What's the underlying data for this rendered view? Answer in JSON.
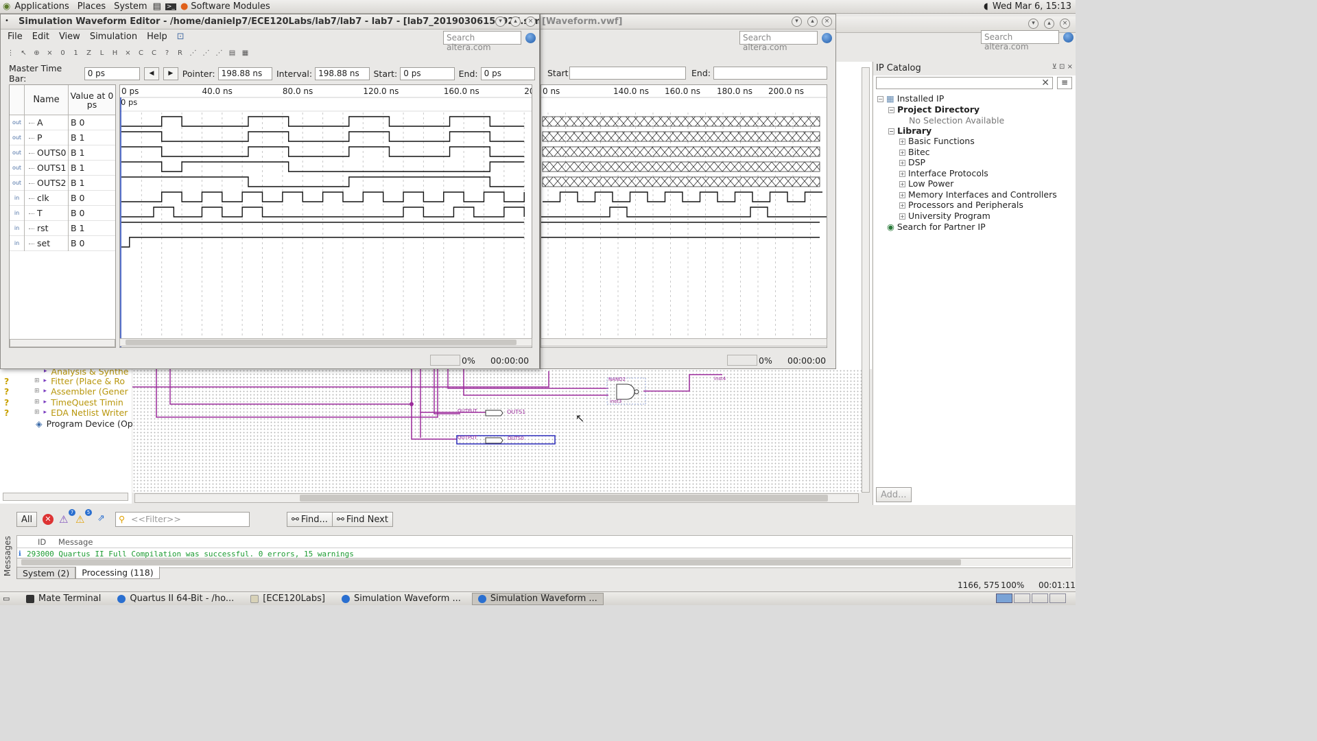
{
  "top_panel": {
    "menus": [
      "Applications",
      "Places",
      "System"
    ],
    "software_modules": "Software Modules",
    "clock": "Wed Mar  6, 15:13"
  },
  "waveform_editor": {
    "title": "Simulation Waveform Editor - /home/danielp7/ECE120Labs/lab7/lab7 - lab7 - [lab7_20190306150927.sim...",
    "search_placeholder": "Search altera.com",
    "menu": [
      "File",
      "Edit",
      "View",
      "Simulation",
      "Help"
    ],
    "master_time_bar_label": "Master Time Bar:",
    "master_time_bar_value": "0 ps",
    "pointer_label": "Pointer:",
    "pointer_value": "198.88 ns",
    "interval_label": "Interval:",
    "interval_value": "198.88 ns",
    "start_label": "Start:",
    "start_value": "0 ps",
    "end_label": "End:",
    "end_value": "0 ps",
    "col_name": "Name",
    "col_value": "Value at 0 ps",
    "time_ticks": [
      "0 ps",
      "40.0 ns",
      "80.0 ns",
      "120.0 ns",
      "160.0 ns",
      "200.0 ns"
    ],
    "cursor_label": "0 ps",
    "signals": [
      {
        "io": "out",
        "name": "A",
        "value": "B 0"
      },
      {
        "io": "out",
        "name": "P",
        "value": "B 1"
      },
      {
        "io": "out",
        "name": "OUTS0",
        "value": "B 1"
      },
      {
        "io": "out",
        "name": "OUTS1",
        "value": "B 1"
      },
      {
        "io": "out",
        "name": "OUTS2",
        "value": "B 1"
      },
      {
        "io": "in",
        "name": "clk",
        "value": "B 0"
      },
      {
        "io": "in",
        "name": "T",
        "value": "B 0"
      },
      {
        "io": "in",
        "name": "rst",
        "value": "B 1"
      },
      {
        "io": "in",
        "name": "set",
        "value": "B 0"
      }
    ],
    "progress": "0%",
    "elapsed": "00:00:00"
  },
  "waveform_editor_2": {
    "title_fragment": "[Waveform.vwf]",
    "search_placeholder": "Search altera.com",
    "start_label": "Start:",
    "end_label": "End:",
    "time_ticks": [
      "0 ns",
      "140.0 ns",
      "160.0 ns",
      "180.0 ns",
      "200.0 ns"
    ],
    "progress": "0%",
    "elapsed": "00:00:00"
  },
  "quartus": {
    "search_placeholder": "Search altera.com"
  },
  "ip_catalog": {
    "title": "IP Catalog",
    "installed_ip": "Installed IP",
    "project_directory": "Project Directory",
    "no_selection": "No Selection Available",
    "library": "Library",
    "library_items": [
      "Basic Functions",
      "Bitec",
      "DSP",
      "Interface Protocols",
      "Low Power",
      "Memory Interfaces and Controllers",
      "Processors and Peripherals",
      "University Program"
    ],
    "partner": "Search for Partner IP",
    "add_button": "Add..."
  },
  "tasks": [
    {
      "status": "?",
      "label": "Analysis & Synthe"
    },
    {
      "status": "?",
      "label": "Fitter (Place & Ro"
    },
    {
      "status": "?",
      "label": "Assembler (Gener"
    },
    {
      "status": "?",
      "label": "TimeQuest Timin"
    },
    {
      "status": "?",
      "label": "EDA Netlist Writer"
    },
    {
      "status": "",
      "label": "Program Device (Op"
    }
  ],
  "schematic": {
    "nand_label": "NAND2",
    "inst3": "inst3",
    "inst4": "inst4",
    "output1": "OUTPUT",
    "outs1": "OUTS1",
    "output0": "OUTPUT",
    "outs0": "OUTS0"
  },
  "messages": {
    "side_label": "Messages",
    "all_button": "All",
    "badge_warning": "7",
    "badge_info": "5",
    "filter_placeholder": "<<Filter>>",
    "find_button": "Find...",
    "find_next_button": "Find Next",
    "col_id": "ID",
    "col_message": "Message",
    "message_text": "293000 Quartus II Full Compilation was successful. 0 errors, 15 warnings",
    "tab_system": "System (2)",
    "tab_processing": "Processing (118)"
  },
  "status_bar": {
    "coords": "1166, 575",
    "zoom": "100%",
    "time": "00:01:11"
  },
  "taskbar": [
    {
      "label": "Mate Terminal",
      "active": false
    },
    {
      "label": "Quartus II 64-Bit - /ho...",
      "active": false
    },
    {
      "label": "[ECE120Labs]",
      "active": false
    },
    {
      "label": "Simulation Waveform ...",
      "active": false
    },
    {
      "label": "Simulation Waveform ...",
      "active": true
    }
  ],
  "waveform_data": {
    "time_range_ns": [
      0,
      200
    ],
    "A": [
      [
        0,
        0
      ],
      [
        20,
        1
      ],
      [
        30,
        0
      ],
      [
        63,
        1
      ],
      [
        83,
        0
      ],
      [
        113,
        1
      ],
      [
        133,
        0
      ],
      [
        163,
        1
      ],
      [
        183,
        0
      ]
    ],
    "P": [
      [
        0,
        1
      ],
      [
        20,
        0
      ],
      [
        63,
        1
      ],
      [
        83,
        0
      ],
      [
        113,
        1
      ],
      [
        133,
        0
      ],
      [
        163,
        1
      ],
      [
        183,
        0
      ]
    ],
    "OUTS0": [
      [
        0,
        1
      ],
      [
        20,
        0
      ],
      [
        63,
        1
      ],
      [
        83,
        0
      ],
      [
        113,
        1
      ],
      [
        133,
        0
      ],
      [
        163,
        1
      ],
      [
        183,
        0
      ]
    ],
    "OUTS1": [
      [
        0,
        1
      ],
      [
        20,
        0
      ],
      [
        30,
        1
      ],
      [
        83,
        0
      ],
      [
        183,
        1
      ]
    ],
    "OUTS2": [
      [
        0,
        1
      ],
      [
        63,
        0
      ],
      [
        113,
        1
      ],
      [
        183,
        0
      ]
    ],
    "clk": [
      [
        0,
        0
      ],
      [
        20,
        1
      ],
      [
        30,
        0
      ],
      [
        40,
        1
      ],
      [
        50,
        0
      ],
      [
        60,
        1
      ],
      [
        70,
        0
      ],
      [
        80,
        1
      ],
      [
        90,
        0
      ],
      [
        100,
        1
      ],
      [
        110,
        0
      ],
      [
        120,
        1
      ],
      [
        130,
        0
      ],
      [
        140,
        1
      ],
      [
        150,
        0
      ],
      [
        160,
        1
      ],
      [
        170,
        0
      ],
      [
        180,
        1
      ],
      [
        190,
        0
      ],
      [
        200,
        1
      ]
    ],
    "T": [
      [
        0,
        0
      ],
      [
        16,
        1
      ],
      [
        26,
        0
      ],
      [
        40,
        1
      ],
      [
        50,
        0
      ],
      [
        60,
        1
      ],
      [
        70,
        0
      ],
      [
        140,
        1
      ],
      [
        150,
        0
      ],
      [
        165,
        1
      ],
      [
        175,
        0
      ],
      [
        190,
        1
      ],
      [
        200,
        0
      ]
    ],
    "rst": [
      [
        0,
        1
      ]
    ],
    "set": [
      [
        0,
        0
      ],
      [
        4,
        1
      ]
    ]
  }
}
